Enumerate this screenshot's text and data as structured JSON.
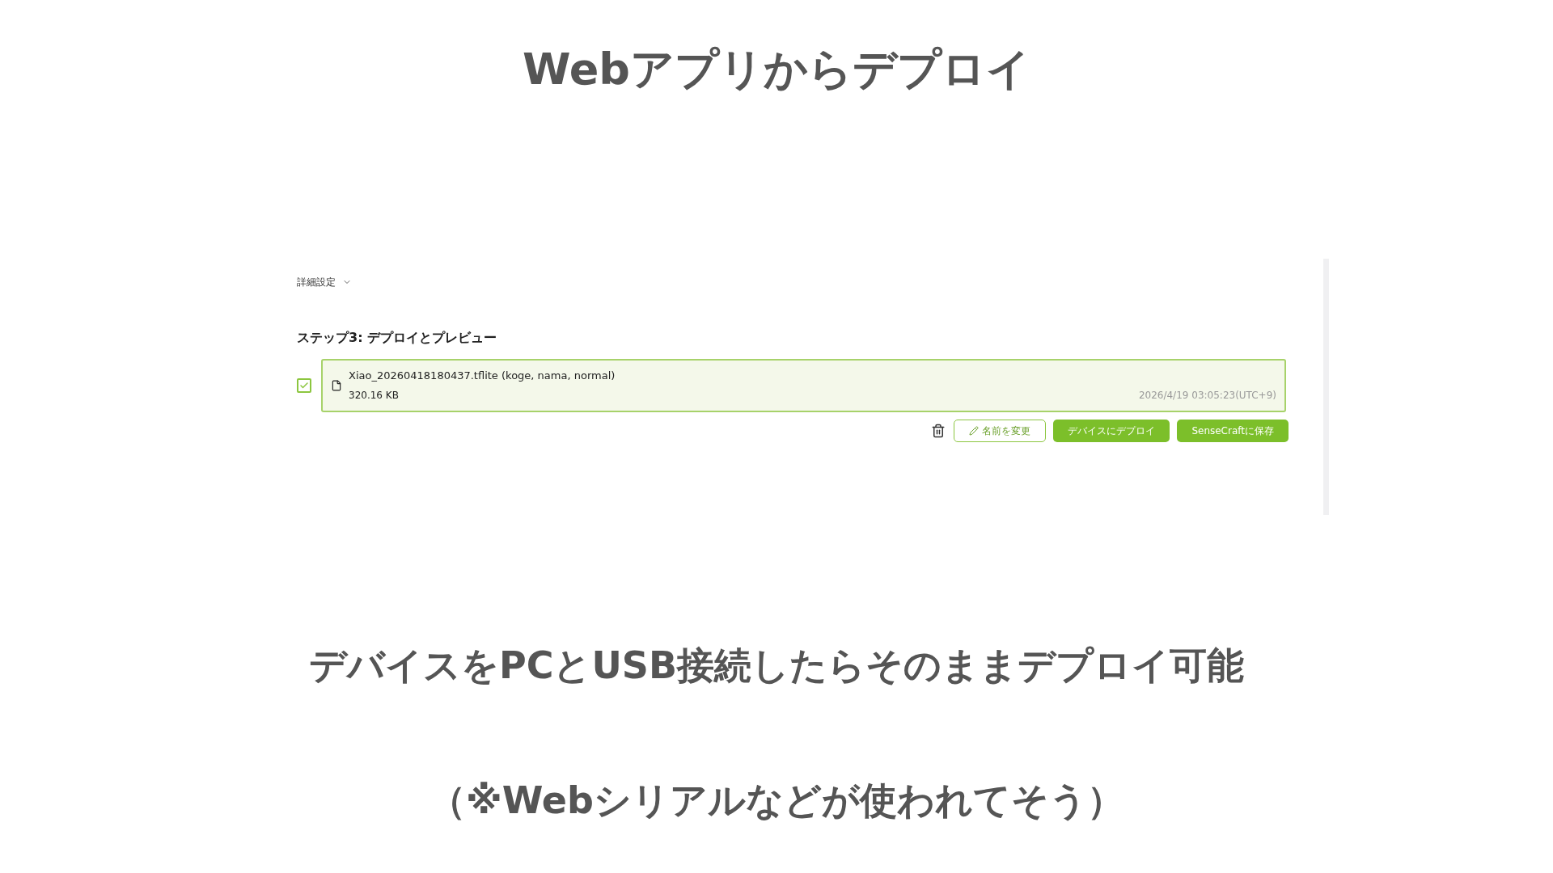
{
  "title": "Webアプリからデプロイ",
  "app": {
    "advanced": {
      "label": "詳細設定",
      "expanded": false
    },
    "step_heading": "ステップ3: デプロイとプレビュー",
    "model": {
      "checked": true,
      "name": "Xiao_20260418180437.tflite (koge, nama, normal)",
      "size": "320.16 KB",
      "timestamp": "2026/4/19 03:05:23(UTC+9)"
    },
    "buttons": [
      {
        "kind": "outline",
        "label": "名前を変更"
      },
      {
        "kind": "primary",
        "label": "デバイスにデプロイ"
      },
      {
        "kind": "primary",
        "label": "SenseCraftに保存"
      }
    ]
  },
  "captions": [
    "デバイスをPCとUSB接続したらそのままデプロイ可能",
    "（※Webシリアルなどが使われてそう）"
  ]
}
